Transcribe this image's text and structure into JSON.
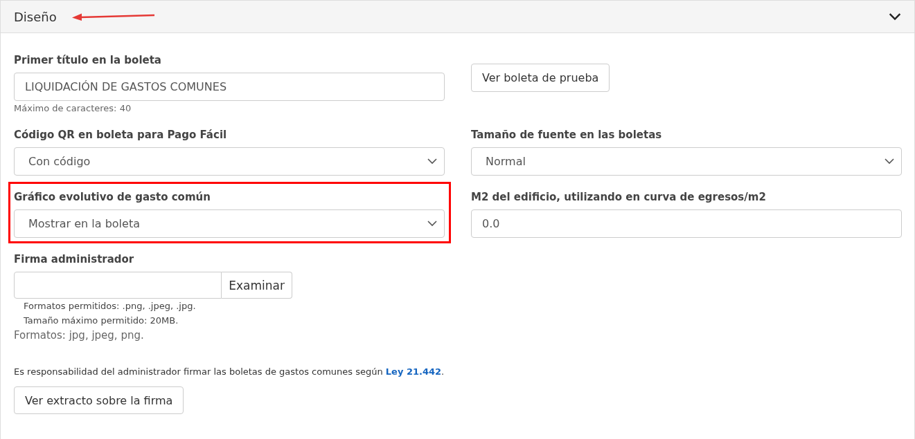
{
  "panel": {
    "title": "Diseño",
    "expanded": true,
    "title_arrow": true
  },
  "fields": [
    {
      "kind": "text",
      "label": "Primer título en la boleta",
      "value": "LIQUIDACIÓN DE GASTOS COMUNES",
      "help": "Máximo de caracteres: 40"
    },
    {
      "kind": "button",
      "label": "Ver boleta de prueba"
    },
    {
      "kind": "select",
      "label": "Código QR en boleta para Pago Fácil",
      "value": "Con código"
    },
    {
      "kind": "select",
      "label": "Tamaño de fuente en las boletas",
      "value": "Normal"
    },
    {
      "kind": "select",
      "label": "Gráfico evolutivo de gasto común",
      "value": "Mostrar en la boleta",
      "highlighted": true
    },
    {
      "kind": "text",
      "label": "M2 del edificio, utilizando en curva de egresos/m2",
      "value": "0.0"
    },
    {
      "kind": "file",
      "label": "Firma administrador",
      "button": "Examinar",
      "hints": [
        "Formatos permitidos: .png, .jpeg, .jpg.",
        "Tamaño máximo permitido: 20MB."
      ],
      "formats": "Formatos: jpg, jpeg, png."
    }
  ],
  "notice": {
    "text": "Es responsabilidad del administrador firmar las boletas de gastos comunes según ",
    "link": "Ley 21.442",
    "after": "."
  },
  "extract_button": "Ver extracto sobre la firma"
}
